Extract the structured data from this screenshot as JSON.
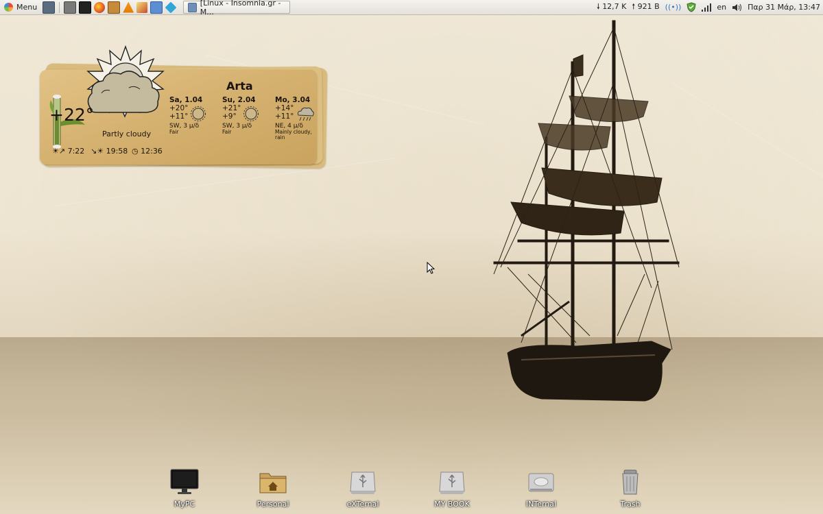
{
  "panel": {
    "menu_label": "Menu",
    "task_title": "[Linux - Insomnia.gr - M...",
    "net_down": "12,7 K",
    "net_up": "921 B",
    "keyboard_layout": "en",
    "clock": "Παρ 31 Μάρ, 13:47",
    "launchers": [
      "show-desktop-icon",
      "file-manager-icon",
      "terminal-icon",
      "firefox-icon",
      "media-player-icon",
      "vlc-icon",
      "image-viewer-icon",
      "network-icon",
      "kodi-icon"
    ]
  },
  "weather": {
    "city": "Arta",
    "temp": "+22°",
    "condition": "Partly cloudy",
    "sunrise": "7:22",
    "sunset": "19:58",
    "daylength": "12:36",
    "forecast": [
      {
        "day": "Sa, 1.04",
        "high": "+20°",
        "low": "+11°",
        "wind": "SW, 3 μ/δ",
        "desc": "Fair",
        "icon": "sun-icon"
      },
      {
        "day": "Su, 2.04",
        "high": "+21°",
        "low": "+9°",
        "wind": "SW, 3 μ/δ",
        "desc": "Fair",
        "icon": "sun-icon"
      },
      {
        "day": "Mo, 3.04",
        "high": "+14°",
        "low": "+11°",
        "wind": "NE, 4 μ/δ",
        "desc": "Mainly cloudy, rain",
        "icon": "rain-cloud-icon"
      }
    ]
  },
  "desktop_icons": [
    {
      "label": "MyPC",
      "icon": "monitor-icon"
    },
    {
      "label": "Personal",
      "icon": "home-folder-icon"
    },
    {
      "label": "eXTernal",
      "icon": "usb-drive-icon"
    },
    {
      "label": "MY BOOK",
      "icon": "usb-drive-icon"
    },
    {
      "label": "INTernal",
      "icon": "hard-drive-icon"
    },
    {
      "label": "Trash",
      "icon": "trash-icon"
    }
  ],
  "colors": {
    "paper": "#d6b271",
    "sepia_sea": "#b9a684",
    "panel_bg": "#ebe8e2"
  }
}
